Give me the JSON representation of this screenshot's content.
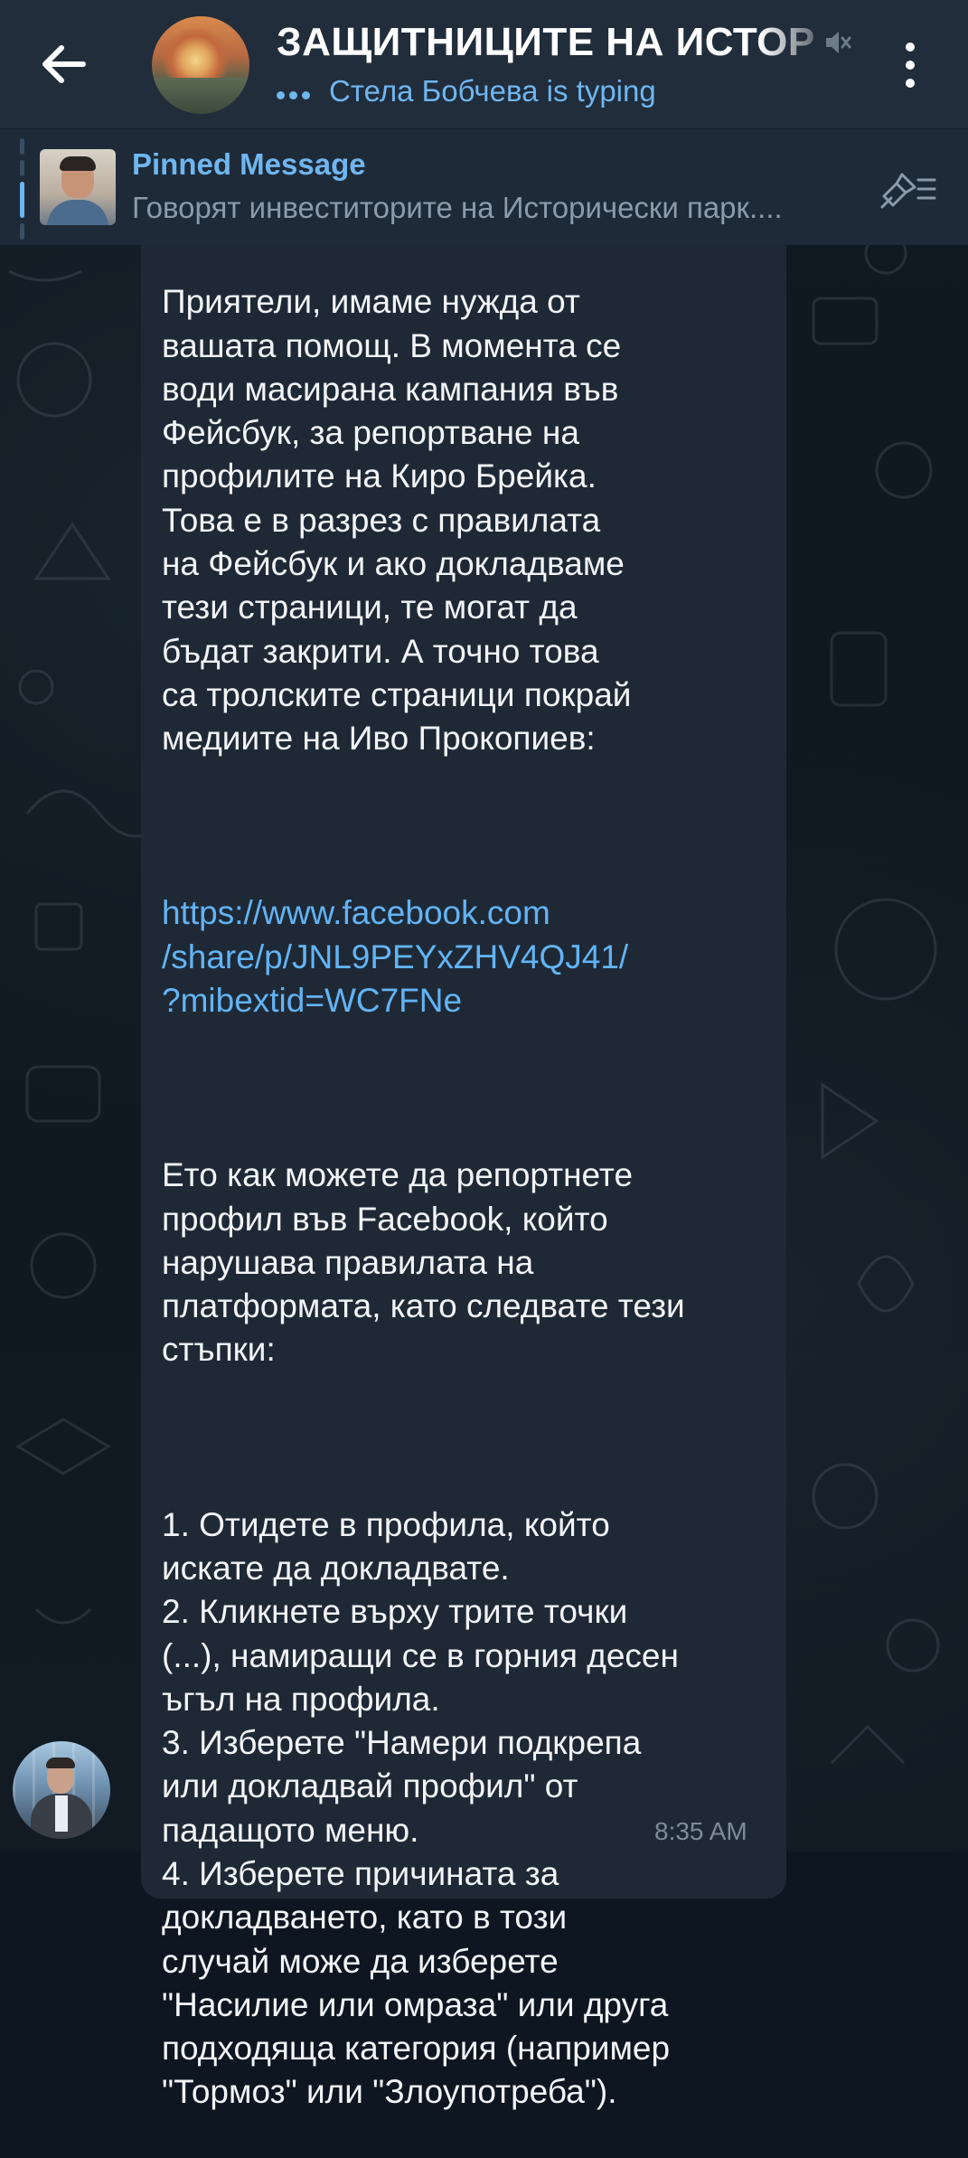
{
  "header": {
    "back_icon": "arrow-left-icon",
    "title": "ЗАЩИТНИЦИТЕ НА ИСТОР",
    "muted_icon": "muted-speaker-icon",
    "typing_status": "Стела Бобчева is typing",
    "more_icon": "vertical-dots-icon"
  },
  "pinned": {
    "label": "Pinned Message",
    "preview": "Говорят инвеститорите на Исторически парк....",
    "list_icon": "pin-list-icon"
  },
  "message": {
    "intro": "Приятели, имаме нужда от\nвашата помощ. В момента се\nводи масирана кампания във\nФейсбук, за репортване на\nпрофилите на Киро Брейка.\nТова е в разрез с правилата\nна Фейсбук и ако докладваме\nтези страници, те могат да\nбъдат закрити. А точно това\nса тролските страници покрай\nмедиите на Иво Прокопиев:",
    "link": "https://www.facebook.com\n/share/p/JNL9PEYxZHV4QJ41/\n?mibextid=WC7FNe",
    "how_to": "Ето как можете да репортнете\nпрофил във Facebook, който\nнарушава правилата на\nплатформата, като следвате тези\nстъпки:",
    "steps": "1. Отидете в профила, който\nискате да докладвате.\n2. Кликнете върху трите точки\n(...), намиращи се в горния десен\nъгъл на профила.\n3. Изберете \"Намери подкрепа\nили докладвай профил\" от\nпадащото меню.\n4. Изберете причината за\nдокладването, като в този\nслучай може да изберете\n\"Насилие или омраза\" или друга\nподходяща категория (например\n\"Тормоз\" или \"Злоупотреба\").",
    "time": "8:35 AM"
  },
  "colors": {
    "header_bg": "#212d3b",
    "accent": "#6fb6f0",
    "bubble_bg": "#1f2936",
    "link": "#62b4f5"
  }
}
